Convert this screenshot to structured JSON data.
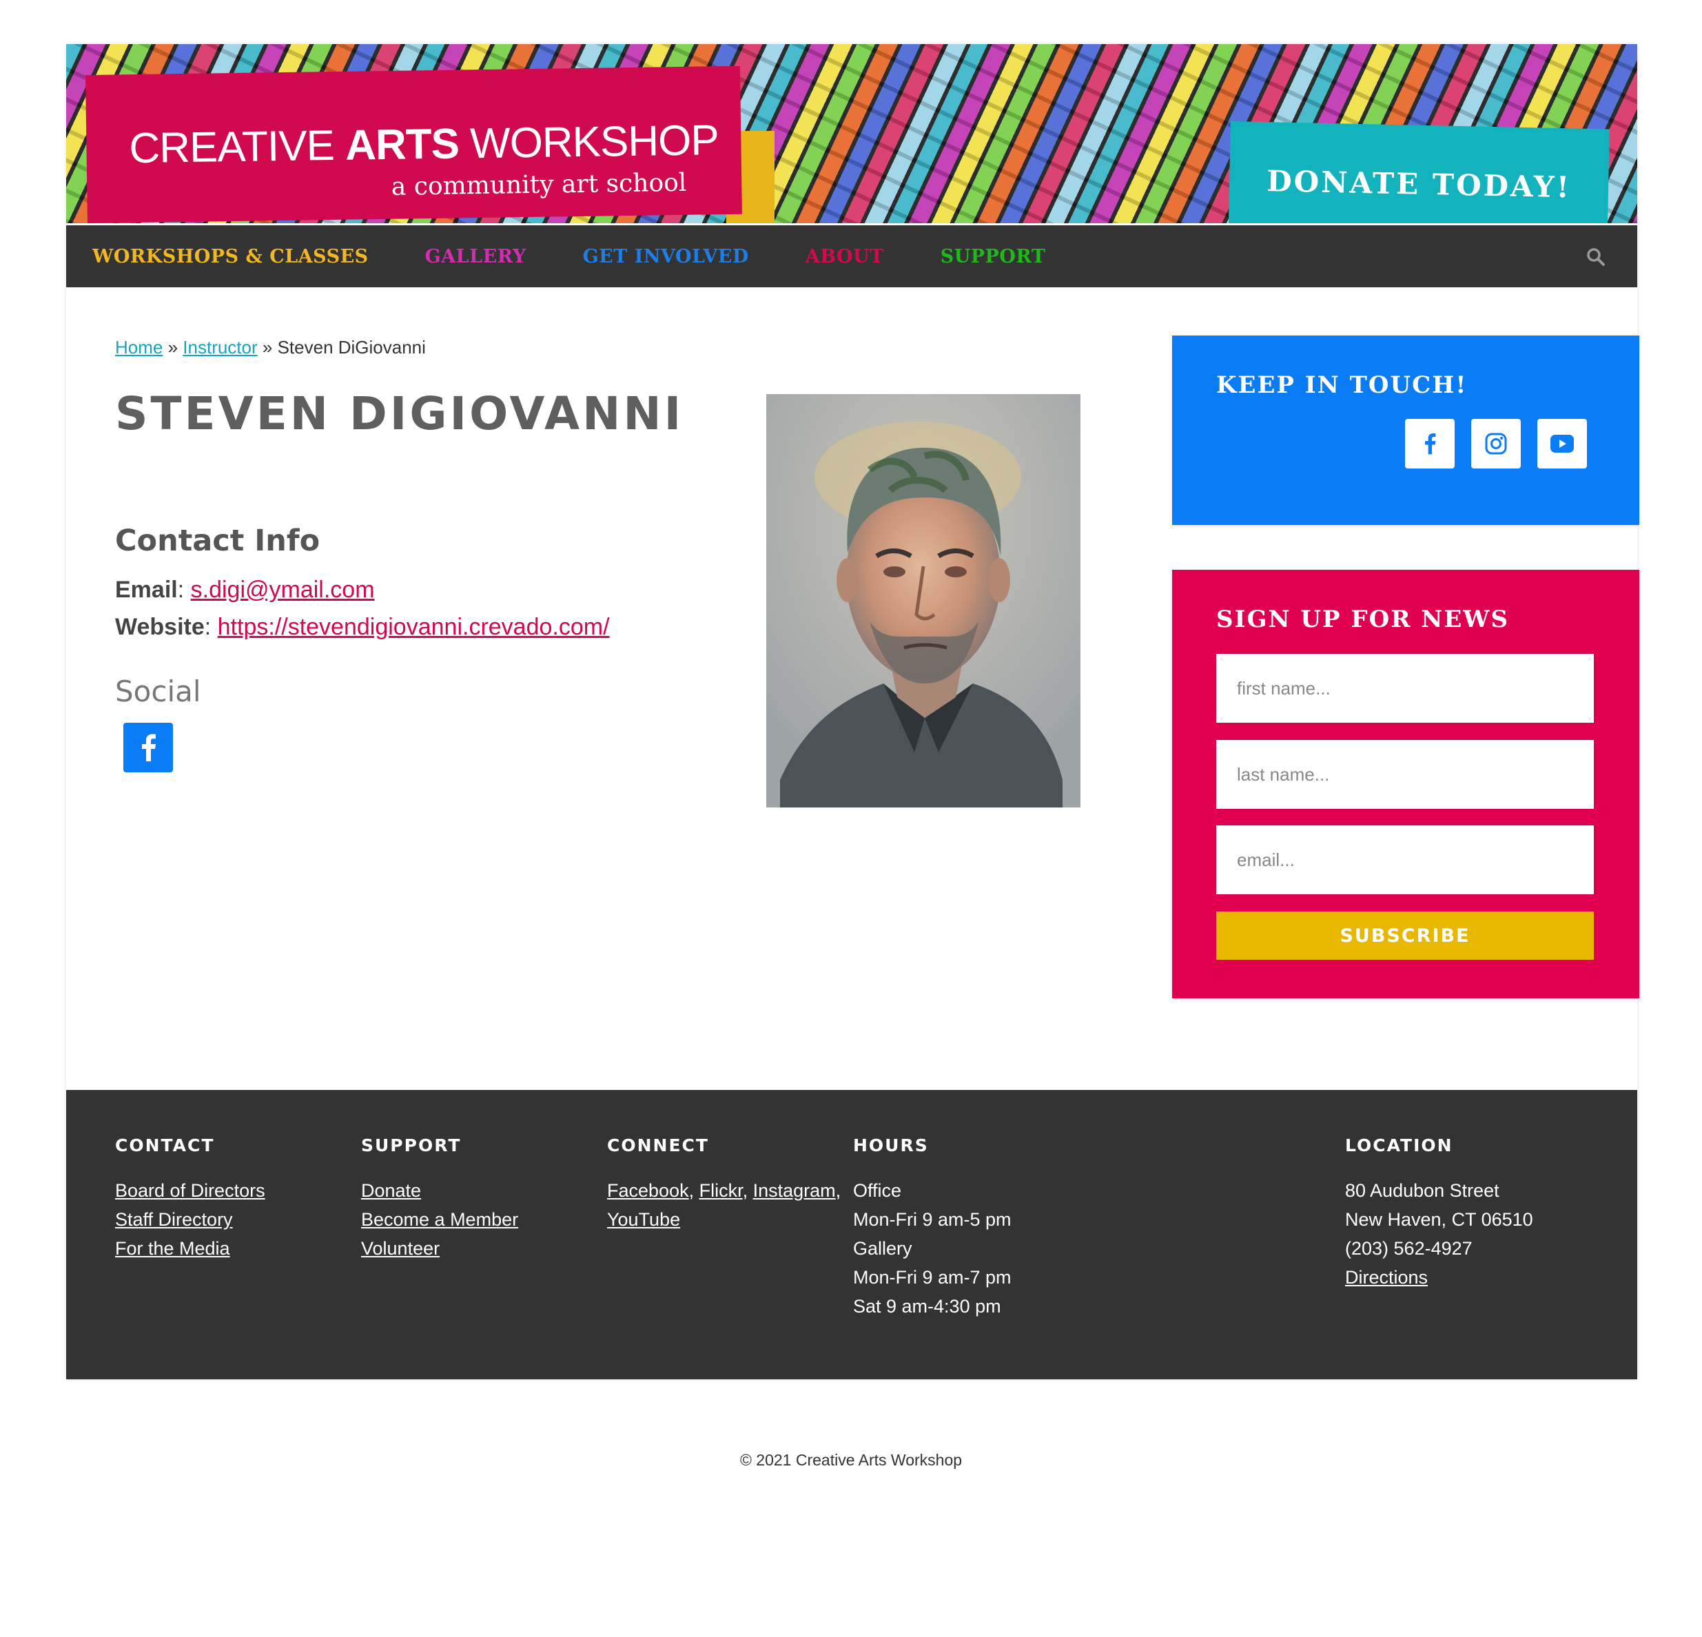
{
  "brand": {
    "title_light_1": "CREATIVE ",
    "title_bold": "ARTS",
    "title_light_2": " WORKSHOP",
    "subtitle": "a community art school",
    "donate": "DONATE TODAY!"
  },
  "nav": {
    "items": [
      {
        "label": "WORKSHOPS & CLASSES",
        "color": "#f2b824"
      },
      {
        "label": "GALLERY",
        "color": "#d52bb3"
      },
      {
        "label": "GET INVOLVED",
        "color": "#1c7ee6"
      },
      {
        "label": "ABOUT",
        "color": "#d10a4f"
      },
      {
        "label": "SUPPORT",
        "color": "#20b91c"
      }
    ],
    "search_icon": "search-icon"
  },
  "breadcrumb": {
    "home": "Home",
    "sep": " » ",
    "instructor": "Instructor",
    "current": "Steven DiGiovanni"
  },
  "profile": {
    "name": "STEVEN DIGIOVANNI",
    "contact_heading": "Contact Info",
    "email_label": "Email",
    "email": "s.digi@ymail.com",
    "website_label": "Website",
    "website": "https://stevendigiovanni.crevado.com/",
    "social_heading": "Social",
    "portrait_alt": "pastel portrait"
  },
  "sidebar": {
    "keep_title": "KEEP IN TOUCH!",
    "signup_title": "SIGN UP FOR NEWS",
    "first_placeholder": "first name...",
    "last_placeholder": "last name...",
    "email_placeholder": "email...",
    "subscribe": "SUBSCRIBE"
  },
  "footer": {
    "contact": {
      "heading": "CONTACT",
      "links": [
        "Board of Directors",
        "Staff Directory",
        "For the Media"
      ]
    },
    "support": {
      "heading": "SUPPORT",
      "links": [
        "Donate",
        "Become a Member",
        "Volunteer"
      ]
    },
    "connect": {
      "heading": "CONNECT",
      "links": [
        "Facebook",
        "Flickr",
        "Instagram",
        "YouTube"
      ]
    },
    "hours": {
      "heading": "HOURS",
      "lines": [
        "Office",
        "Mon-Fri 9 am-5 pm",
        "Gallery",
        "Mon-Fri 9 am-7 pm",
        "Sat 9 am-4:30 pm"
      ]
    },
    "location": {
      "heading": "LOCATION",
      "lines": [
        "80 Audubon Street",
        "New Haven, CT 06510",
        "(203) 562-4927"
      ],
      "directions": "Directions"
    }
  },
  "copyright": "© 2021 Creative Arts Workshop",
  "colors": {
    "nav_bg": "#333333",
    "keep_bg": "#0a7cf5",
    "signup_bg": "#e0004f",
    "subscribe_bg": "#e8b800",
    "link_red": "#d10a4f",
    "link_teal": "#14a5c0"
  }
}
